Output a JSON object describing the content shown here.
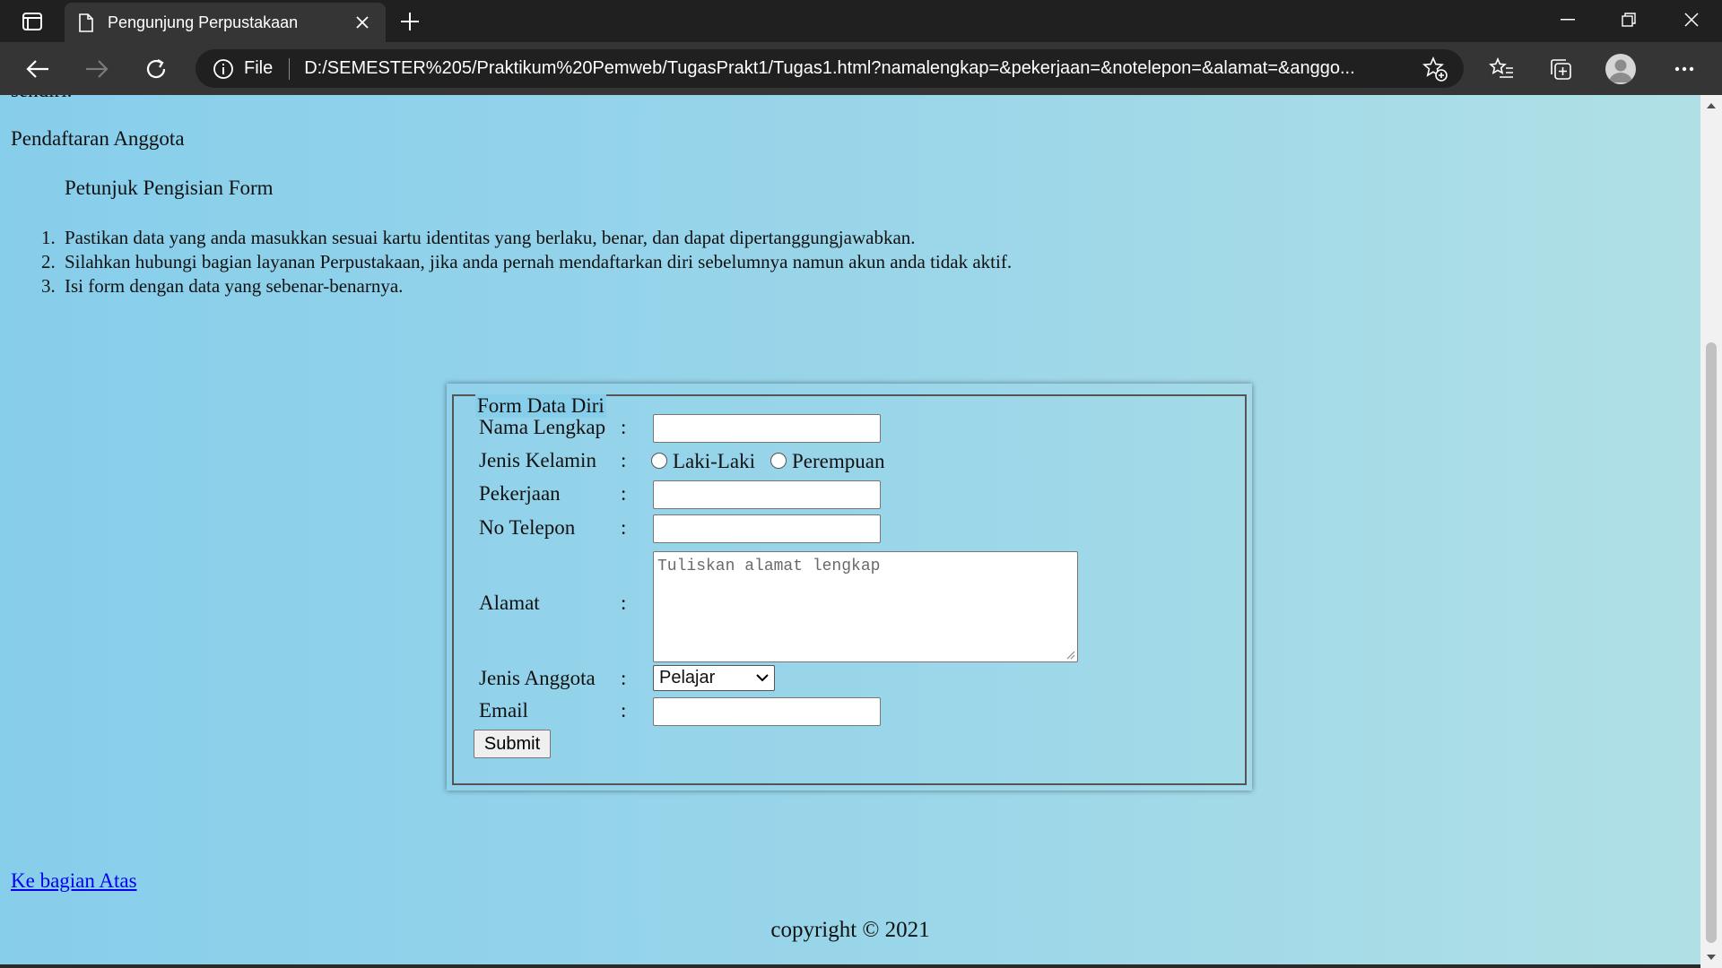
{
  "browser": {
    "tab_title": "Pengunjung Perpustakaan",
    "address_scheme": "File",
    "address_url": "D:/SEMESTER%205/Praktikum%20Pemweb/TugasPrakt1/Tugas1.html?namalengkap=&pekerjaan=&notelepon=&alamat=&anggo..."
  },
  "icons": {
    "tab_actions": "tab-actions-icon",
    "document": "document-icon",
    "close": "close-icon",
    "new_tab": "plus-icon",
    "back": "back-arrow-icon",
    "forward": "forward-arrow-icon",
    "refresh": "refresh-icon",
    "info": "info-icon",
    "add_favorite": "star-plus-icon",
    "favorites": "favorites-icon",
    "collections": "collections-icon",
    "profile": "avatar",
    "more": "more-icon"
  },
  "page": {
    "cut_text": "sendiri.",
    "registration_heading": "Pendaftaran Anggota",
    "guide_heading": "Petunjuk Pengisian Form",
    "guide_items": [
      {
        "num": "1.",
        "text": "Pastikan data yang anda masukkan sesuai kartu identitas yang berlaku, benar, dan dapat dipertanggungjawabkan."
      },
      {
        "num": "2.",
        "text": "Silahkan hubungi bagian layanan Perpustakaan, jika anda pernah mendaftarkan diri sebelumnya namun akun anda tidak aktif."
      },
      {
        "num": "3.",
        "text": "Isi form dengan data yang sebenar-benarnya."
      }
    ],
    "back_to_top": "Ke bagian Atas",
    "copyright": "copyright © 2021"
  },
  "form": {
    "legend": "Form Data Diri",
    "colon": ":",
    "nama_label": "Nama Lengkap",
    "nama_value": "",
    "gender_label": "Jenis Kelamin",
    "gender_options": [
      "Laki-Laki",
      "Perempuan"
    ],
    "pekerjaan_label": "Pekerjaan",
    "pekerjaan_value": "",
    "telepon_label": "No Telepon",
    "telepon_value": "",
    "alamat_label": "Alamat",
    "alamat_placeholder": "Tuliskan alamat lengkap",
    "anggota_label": "Jenis Anggota",
    "anggota_selected": "Pelajar",
    "email_label": "Email",
    "email_value": "",
    "submit_label": "Submit"
  },
  "colors": {
    "page_bg_left": "#87ceeb",
    "page_bg_right": "#b0e0e6",
    "link": "#0000ee",
    "chrome_dark": "#202020",
    "chrome_toolbar": "#353535"
  }
}
